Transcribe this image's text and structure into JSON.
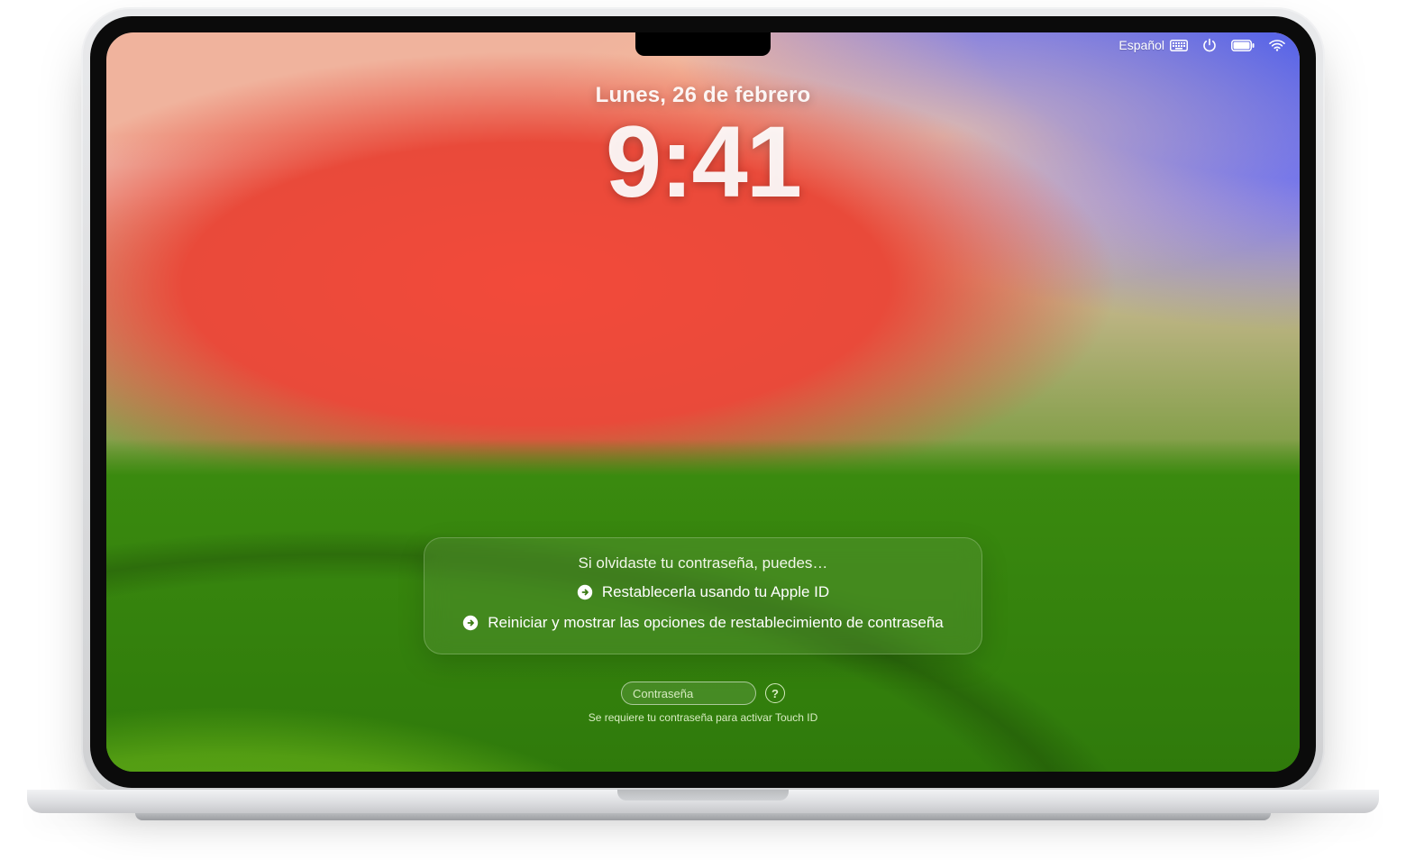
{
  "menubar": {
    "input_label": "Español",
    "icons": {
      "keyboard": "keyboard-icon",
      "power": "power-icon",
      "battery": "battery-icon",
      "wifi": "wifi-icon"
    }
  },
  "clock": {
    "date": "Lunes, 26 de febrero",
    "time": "9:41"
  },
  "forgot_panel": {
    "title": "Si olvidaste tu contraseña, puedes…",
    "option_apple_id": "Restablecerla usando tu Apple ID",
    "option_restart": "Reiniciar y mostrar las opciones de restablecimiento de contraseña"
  },
  "login": {
    "password_placeholder": "Contraseña",
    "hint_glyph": "?",
    "touchid_note": "Se requiere tu contraseña para activar Touch ID"
  }
}
